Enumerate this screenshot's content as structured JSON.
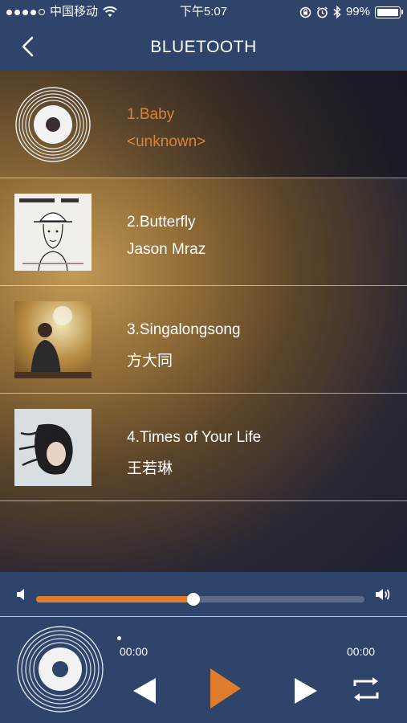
{
  "status_bar": {
    "carrier": "中国移动",
    "time": "下午5:07",
    "battery": "99%"
  },
  "header": {
    "title": "BLUETOOTH"
  },
  "tracks": [
    {
      "name": "1.Baby",
      "artist": "<unknown>",
      "active": true
    },
    {
      "name": "2.Butterfly",
      "artist": "Jason Mraz",
      "active": false
    },
    {
      "name": "3.Singalongsong",
      "artist": "方大同",
      "active": false
    },
    {
      "name": "4.Times of Your Life",
      "artist": "王若琳",
      "active": false
    }
  ],
  "volume": {
    "level": 0.48
  },
  "player": {
    "elapsed": "00:00",
    "duration": "00:00"
  },
  "colors": {
    "accent": "#e07d2c",
    "bar": "#2f446a"
  }
}
